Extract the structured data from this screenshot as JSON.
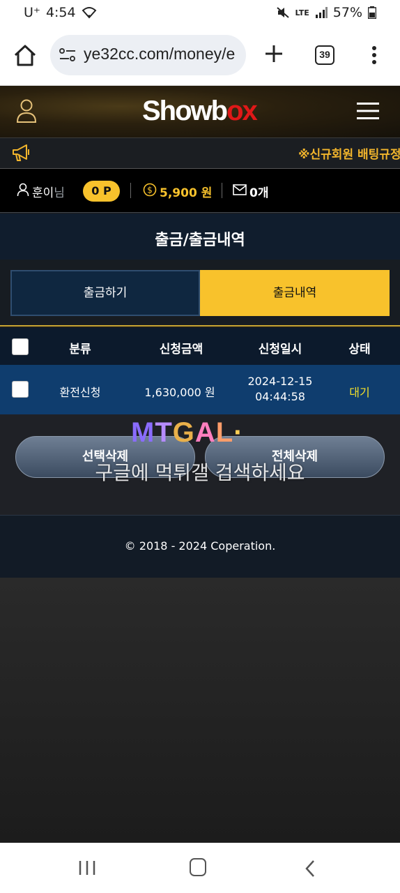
{
  "status_bar": {
    "carrier": "U⁺",
    "time": "4:54",
    "network": "LTE",
    "battery": "57%"
  },
  "browser": {
    "url": "ye32cc.com/money/e",
    "tab_count": "39"
  },
  "site": {
    "logo_white": "Showb",
    "logo_red": "ox",
    "ticker": "※신규회원 배팅규정"
  },
  "user": {
    "nickname": "훈이님",
    "nickname_suffix": "님",
    "points": "0 P",
    "money": "5,900 원",
    "messages": "0개"
  },
  "page": {
    "title": "출금/출금내역",
    "tabs": [
      {
        "label": "출금하기",
        "active": false
      },
      {
        "label": "출금내역",
        "active": true
      }
    ]
  },
  "table": {
    "headers": [
      "분류",
      "신청금액",
      "신청일시",
      "상태"
    ],
    "rows": [
      {
        "category": "환전신청",
        "amount": "1,630,000 원",
        "date": "2024-12-15",
        "time": "04:44:58",
        "status": "대기"
      }
    ]
  },
  "actions": {
    "delete_selected": "선택삭제",
    "delete_all": "전체삭제"
  },
  "watermark": {
    "logo": [
      "M",
      "T",
      "G",
      "A",
      "L",
      "·"
    ],
    "text": "구글에 먹튀갤 검색하세요"
  },
  "footer": {
    "copyright": "© 2018 - 2024 Coperation."
  },
  "colors": {
    "accent_yellow": "#f8c22c",
    "status_wait": "#f4e02a",
    "row_blue": "#0f3d6e",
    "logo_red": "#e01818"
  }
}
